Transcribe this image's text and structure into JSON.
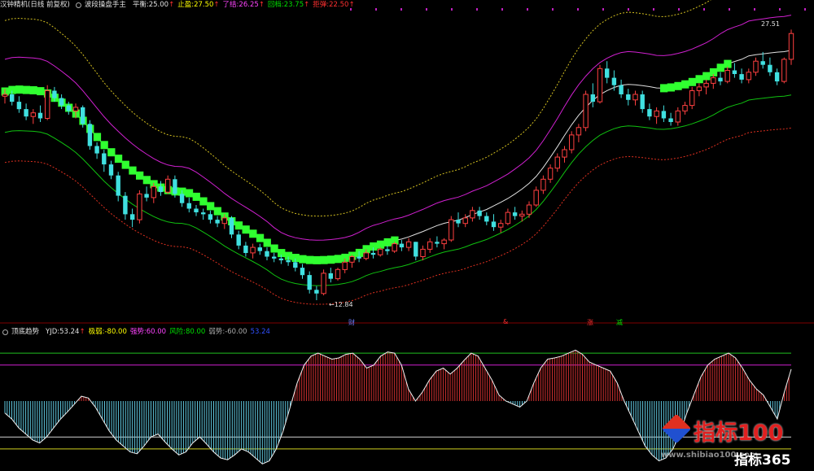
{
  "main_header": {
    "stock": "汉钟精机(日线 前复权)",
    "indicator": "波段操盘手主",
    "items": [
      {
        "label": "平衡:",
        "value": "25.00",
        "color": "#e0e0e0"
      },
      {
        "label": "止盈:",
        "value": "27.50",
        "color": "#ffff00"
      },
      {
        "label": "了结:",
        "value": "26.25",
        "color": "#ff44ff"
      },
      {
        "label": "回档:",
        "value": "23.75",
        "color": "#00e000"
      },
      {
        "label": "拒弹:",
        "value": "22.50",
        "color": "#ff3030"
      }
    ],
    "arrow": "↑"
  },
  "main_annotations": {
    "high": "27.51",
    "low": "12.84",
    "low_arrow": "←"
  },
  "event_markers": [
    {
      "text": "财",
      "color": "#6e7cff"
    },
    {
      "text": "&",
      "color": "#ff3030"
    },
    {
      "text": "涨",
      "color": "#ff3030"
    },
    {
      "text": "减",
      "color": "#00e000"
    }
  ],
  "sub_header": {
    "indicator": "顶底趋势",
    "items": [
      {
        "label": "YJD:",
        "value": "53.24",
        "color": "#e0e0e0",
        "arrow": "↑"
      },
      {
        "label": "极弱:",
        "value": "-80.00",
        "color": "#ffff00",
        "arrow": ""
      },
      {
        "label": "强势:",
        "value": "60.00",
        "color": "#ff44ff",
        "arrow": ""
      },
      {
        "label": "风险:",
        "value": "80.00",
        "color": "#00e000",
        "arrow": ""
      },
      {
        "label": "弱势:",
        "value": "-60.00",
        "color": "#aaaaaa",
        "arrow": ""
      },
      {
        "label": "",
        "value": "53.24",
        "color": "#3050ff",
        "arrow": ""
      }
    ]
  },
  "watermark": {
    "brand1": "指标100",
    "url": "www.shibiao100.com",
    "brand2": "指标365"
  },
  "chart_data": {
    "type": "candlestick",
    "price_range": [
      12.0,
      28.5
    ],
    "bands": {
      "green_band_value": "25.00",
      "bands_listed": [
        "平衡",
        "止盈",
        "了结",
        "回档",
        "拒弹"
      ]
    },
    "candles": [
      [
        23.9,
        24.3,
        23.5,
        24.0
      ],
      [
        24.0,
        24.2,
        23.4,
        23.6
      ],
      [
        23.6,
        23.9,
        23.0,
        23.2
      ],
      [
        23.2,
        23.5,
        22.6,
        22.8
      ],
      [
        22.8,
        23.2,
        22.4,
        23.0
      ],
      [
        23.0,
        23.4,
        22.5,
        22.7
      ],
      [
        22.7,
        24.5,
        22.6,
        24.2
      ],
      [
        24.2,
        24.4,
        23.6,
        23.8
      ],
      [
        23.8,
        24.0,
        23.2,
        23.4
      ],
      [
        23.4,
        23.6,
        22.9,
        23.1
      ],
      [
        23.1,
        23.5,
        22.7,
        23.3
      ],
      [
        23.3,
        23.4,
        22.2,
        22.4
      ],
      [
        22.4,
        22.6,
        21.0,
        21.2
      ],
      [
        21.2,
        21.4,
        20.5,
        20.8
      ],
      [
        20.8,
        21.0,
        19.8,
        20.2
      ],
      [
        20.2,
        20.4,
        19.4,
        19.6
      ],
      [
        19.6,
        19.8,
        18.2,
        18.5
      ],
      [
        18.5,
        18.7,
        17.2,
        17.5
      ],
      [
        17.5,
        17.8,
        16.8,
        17.2
      ],
      [
        17.2,
        18.8,
        17.0,
        18.6
      ],
      [
        18.6,
        19.0,
        18.2,
        18.4
      ],
      [
        18.4,
        19.2,
        18.1,
        19.0
      ],
      [
        19.0,
        19.3,
        18.5,
        18.7
      ],
      [
        18.7,
        19.6,
        18.6,
        19.4
      ],
      [
        19.4,
        19.6,
        18.4,
        18.6
      ],
      [
        18.6,
        18.8,
        17.9,
        18.1
      ],
      [
        18.1,
        18.4,
        17.6,
        17.8
      ],
      [
        17.8,
        18.0,
        17.4,
        17.6
      ],
      [
        17.6,
        17.8,
        17.2,
        17.5
      ],
      [
        17.5,
        17.7,
        17.0,
        17.2
      ],
      [
        17.2,
        17.4,
        16.8,
        17.0
      ],
      [
        17.0,
        17.5,
        16.7,
        17.3
      ],
      [
        17.3,
        17.4,
        16.2,
        16.4
      ],
      [
        16.4,
        16.6,
        15.6,
        15.8
      ],
      [
        15.8,
        16.0,
        15.2,
        15.4
      ],
      [
        15.4,
        15.9,
        15.1,
        15.7
      ],
      [
        15.7,
        15.9,
        15.3,
        15.5
      ],
      [
        15.5,
        15.7,
        15.0,
        15.2
      ],
      [
        15.2,
        15.4,
        14.9,
        15.1
      ],
      [
        15.1,
        15.3,
        14.8,
        15.0
      ],
      [
        15.0,
        15.2,
        14.7,
        14.9
      ],
      [
        14.9,
        15.1,
        14.4,
        14.6
      ],
      [
        14.6,
        14.8,
        14.0,
        14.2
      ],
      [
        14.2,
        14.4,
        13.2,
        13.4
      ],
      [
        13.4,
        13.6,
        12.84,
        13.2
      ],
      [
        13.2,
        14.5,
        13.1,
        14.3
      ],
      [
        14.3,
        14.6,
        13.8,
        14.0
      ],
      [
        14.0,
        14.6,
        13.9,
        14.5
      ],
      [
        14.5,
        15.1,
        14.3,
        14.9
      ],
      [
        14.9,
        15.3,
        14.6,
        15.2
      ],
      [
        15.2,
        15.5,
        14.9,
        15.1
      ],
      [
        15.1,
        15.6,
        15.0,
        15.4
      ],
      [
        15.4,
        15.7,
        15.1,
        15.3
      ],
      [
        15.3,
        15.7,
        15.2,
        15.6
      ],
      [
        15.6,
        15.8,
        15.3,
        15.5
      ],
      [
        15.5,
        16.0,
        15.4,
        15.9
      ],
      [
        15.9,
        16.1,
        15.5,
        15.7
      ],
      [
        15.7,
        16.2,
        15.5,
        16.0
      ],
      [
        16.0,
        16.0,
        15.0,
        15.2
      ],
      [
        15.2,
        15.8,
        15.0,
        15.6
      ],
      [
        15.6,
        16.2,
        15.4,
        16.0
      ],
      [
        16.0,
        16.3,
        15.7,
        15.9
      ],
      [
        15.9,
        16.2,
        15.6,
        16.1
      ],
      [
        16.1,
        17.4,
        16.0,
        17.2
      ],
      [
        17.2,
        17.6,
        16.8,
        17.0
      ],
      [
        17.0,
        17.5,
        16.8,
        17.3
      ],
      [
        17.3,
        17.9,
        17.1,
        17.7
      ],
      [
        17.7,
        17.9,
        17.2,
        17.4
      ],
      [
        17.4,
        17.6,
        16.9,
        17.1
      ],
      [
        17.1,
        17.5,
        16.6,
        16.8
      ],
      [
        16.8,
        17.2,
        16.5,
        17.0
      ],
      [
        17.0,
        17.8,
        16.9,
        17.6
      ],
      [
        17.6,
        17.9,
        17.2,
        17.4
      ],
      [
        17.4,
        17.7,
        17.1,
        17.5
      ],
      [
        17.5,
        18.2,
        17.3,
        18.0
      ],
      [
        18.0,
        19.0,
        17.9,
        18.8
      ],
      [
        18.8,
        19.6,
        18.6,
        19.4
      ],
      [
        19.4,
        20.2,
        19.2,
        20.0
      ],
      [
        20.0,
        20.8,
        19.8,
        20.6
      ],
      [
        20.6,
        21.2,
        20.3,
        21.0
      ],
      [
        21.0,
        22.0,
        20.8,
        21.8
      ],
      [
        21.8,
        22.4,
        21.4,
        22.2
      ],
      [
        22.2,
        24.2,
        22.0,
        24.0
      ],
      [
        24.0,
        24.6,
        23.3,
        23.6
      ],
      [
        23.6,
        25.6,
        23.5,
        25.4
      ],
      [
        25.4,
        25.8,
        24.6,
        24.9
      ],
      [
        24.9,
        25.3,
        24.2,
        24.5
      ],
      [
        24.5,
        24.8,
        23.8,
        24.0
      ],
      [
        24.0,
        24.3,
        23.4,
        23.7
      ],
      [
        23.7,
        24.2,
        23.4,
        24.0
      ],
      [
        24.0,
        24.2,
        23.0,
        23.2
      ],
      [
        23.2,
        23.5,
        22.6,
        22.8
      ],
      [
        22.8,
        23.3,
        22.4,
        23.1
      ],
      [
        23.1,
        23.4,
        22.5,
        22.7
      ],
      [
        22.7,
        23.0,
        22.3,
        22.5
      ],
      [
        22.5,
        23.3,
        22.3,
        23.1
      ],
      [
        23.1,
        23.6,
        22.9,
        23.4
      ],
      [
        23.4,
        24.4,
        23.2,
        24.2
      ],
      [
        24.2,
        24.6,
        23.9,
        24.4
      ],
      [
        24.4,
        24.8,
        24.0,
        24.6
      ],
      [
        24.6,
        25.1,
        24.3,
        24.9
      ],
      [
        24.9,
        25.2,
        24.5,
        24.7
      ],
      [
        24.7,
        25.5,
        24.6,
        25.3
      ],
      [
        25.3,
        25.7,
        24.9,
        25.1
      ],
      [
        25.1,
        25.4,
        24.6,
        24.8
      ],
      [
        24.8,
        25.4,
        24.6,
        25.2
      ],
      [
        25.2,
        26.0,
        25.0,
        25.8
      ],
      [
        25.8,
        26.3,
        25.4,
        25.6
      ],
      [
        25.6,
        26.0,
        25.0,
        25.2
      ],
      [
        25.2,
        25.4,
        24.5,
        24.7
      ],
      [
        24.7,
        26.0,
        24.6,
        25.9
      ],
      [
        25.9,
        27.51,
        25.6,
        27.3
      ]
    ],
    "oscillator": {
      "range": [
        -100,
        100
      ],
      "levels": {
        "风险": 80,
        "强势": 60,
        "弱势": -60,
        "极弱": -80
      },
      "last_value": 53.24,
      "yjd": [
        -20,
        -30,
        -45,
        -55,
        -65,
        -70,
        -60,
        -45,
        -30,
        -18,
        -5,
        8,
        5,
        -10,
        -30,
        -50,
        -65,
        -75,
        -85,
        -88,
        -75,
        -60,
        -55,
        -68,
        -80,
        -90,
        -85,
        -70,
        -60,
        -72,
        -85,
        -95,
        -98,
        -90,
        -80,
        -85,
        -95,
        -105,
        -100,
        -80,
        -50,
        -10,
        30,
        60,
        75,
        80,
        75,
        70,
        72,
        78,
        80,
        70,
        55,
        60,
        75,
        82,
        80,
        60,
        20,
        0,
        15,
        35,
        50,
        55,
        45,
        55,
        68,
        80,
        75,
        55,
        35,
        10,
        0,
        -5,
        -10,
        0,
        30,
        55,
        70,
        72,
        75,
        80,
        85,
        78,
        65,
        60,
        55,
        50,
        30,
        0,
        -25,
        -50,
        -75,
        -90,
        -100,
        -95,
        -80,
        -55,
        -20,
        10,
        40,
        60,
        70,
        75,
        80,
        72,
        55,
        35,
        20,
        10,
        -10,
        -30,
        15,
        53.24
      ]
    }
  }
}
